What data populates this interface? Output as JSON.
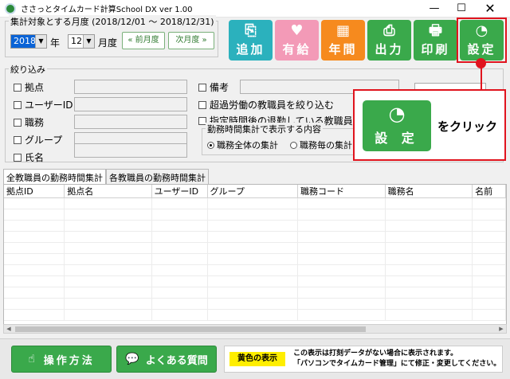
{
  "window": {
    "title": "ささっとタイムカード計算School DX  ver 1.00",
    "min": "—",
    "max": "☐",
    "close": "✕"
  },
  "period": {
    "legend": "集計対象とする月度 (2018/12/01 〜 2018/12/31)",
    "year": "2018",
    "year_suffix": "年",
    "month": "12",
    "month_suffix": "月度",
    "prev_label": "« 前月度",
    "next_label": "次月度 »"
  },
  "toolbar": [
    {
      "key": "add",
      "label": "追加",
      "icon": "⎘"
    },
    {
      "key": "leave",
      "label": "有給",
      "icon": "♥"
    },
    {
      "key": "year",
      "label": "年間",
      "icon": "▦"
    },
    {
      "key": "output",
      "label": "出力",
      "icon": "⎙"
    },
    {
      "key": "print",
      "label": "印刷",
      "icon": "🖶"
    },
    {
      "key": "setting",
      "label": "設定",
      "icon": "◔"
    }
  ],
  "filter": {
    "legend": "絞り込み",
    "left": [
      "拠点",
      "ユーザーID",
      "職務",
      "グループ",
      "氏名"
    ],
    "remarks": "備考",
    "overtime": "超過労働の教職員を絞り込む",
    "late_leave": "指定時間後の退勤している教職員を",
    "work_group_legend": "勤務時間集計で表示する内容",
    "radio_all": "職務全体の集計",
    "radio_each": "職務毎の集計"
  },
  "callout": {
    "button_label": "設 定",
    "button_icon": "◔",
    "text": "をクリック"
  },
  "tabs": [
    "全教職員の勤務時間集計",
    "各教職員の勤務時間集計"
  ],
  "grid": {
    "columns": [
      "拠点ID",
      "拠点名",
      "ユーザーID",
      "グループ",
      "職務コード",
      "職務名",
      "名前"
    ],
    "row_count": 11
  },
  "scroll": {
    "left": "◀",
    "right": "▶"
  },
  "bottom": {
    "manual_label": "操作方法",
    "manual_icon": "☝",
    "faq_label": "よくある質問",
    "faq_icon": "💬",
    "yellow_tag": "黄色の表示",
    "note_line1": "この表示は打刻データがない場合に表示されます。",
    "note_line2": "「パソコンでタイムカード管理」にて修正・変更してください。"
  }
}
